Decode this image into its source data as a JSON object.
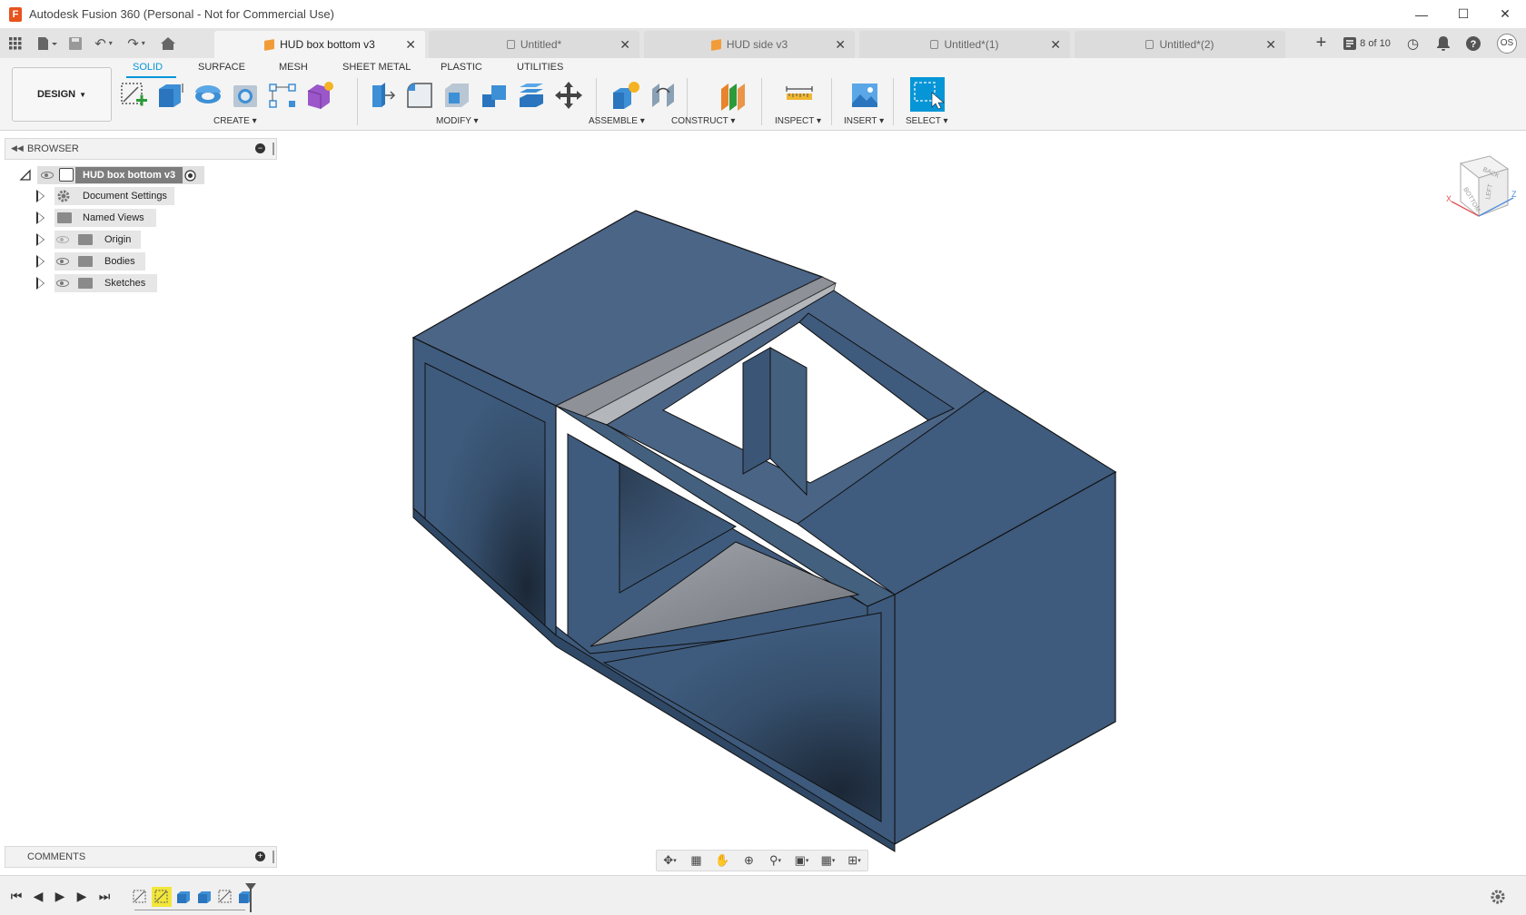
{
  "window": {
    "title": "Autodesk Fusion 360 (Personal - Not for Commercial Use)",
    "minimize_icon": "minimize-icon",
    "maximize_icon": "maximize-icon",
    "close_icon": "close-icon"
  },
  "tabs": [
    {
      "label": "HUD box bottom v3",
      "icon": "part-cube-icon",
      "active": true
    },
    {
      "label": "Untitled*",
      "icon": "lock-icon",
      "active": false
    },
    {
      "label": "HUD side v3",
      "icon": "part-cube-icon",
      "active": false
    },
    {
      "label": "Untitled*(1)",
      "icon": "lock-icon",
      "active": false
    },
    {
      "label": "Untitled*(2)",
      "icon": "lock-icon",
      "active": false
    }
  ],
  "tab_count": "8 of 10",
  "user_initials": "OS",
  "toolbar": {
    "workspace": "DESIGN",
    "workspace_tabs": [
      "SOLID",
      "SURFACE",
      "MESH",
      "SHEET METAL",
      "PLASTIC",
      "UTILITIES"
    ],
    "groups": [
      "CREATE",
      "MODIFY",
      "ASSEMBLE",
      "CONSTRUCT",
      "INSPECT",
      "INSERT",
      "SELECT"
    ]
  },
  "browser": {
    "title": "BROWSER",
    "root": "HUD box bottom v3",
    "items": [
      "Document Settings",
      "Named Views",
      "Origin",
      "Bodies",
      "Sketches"
    ]
  },
  "comments": {
    "title": "COMMENTS"
  },
  "viewcube": {
    "faces": [
      "BACK",
      "BOTTOM",
      "LEFT"
    ],
    "axes": [
      "X",
      "Z"
    ]
  },
  "colors": {
    "body": "#3d5a7c",
    "accent": "#0696d7",
    "face_highlight": "#8e8e96"
  }
}
